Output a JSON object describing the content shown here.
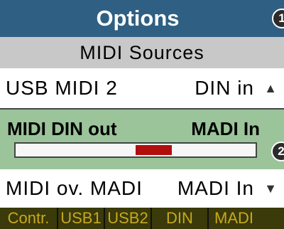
{
  "window": {
    "title": "Options"
  },
  "badges": {
    "one": "1",
    "two": "2"
  },
  "subheader": {
    "text": "MIDI Sources"
  },
  "rows": {
    "usb": {
      "label": "USB MIDI 2",
      "value": "DIN in",
      "arrow": "▲"
    },
    "selected": {
      "label": "MIDI DIN out",
      "value": "MADI In",
      "level": {
        "start_fraction": 0.5,
        "end_fraction": 0.65
      }
    },
    "madi": {
      "label": "MIDI ov. MADI",
      "value": "MADI In",
      "arrow": "▼"
    }
  },
  "tabs": [
    {
      "label": "Contr."
    },
    {
      "label": "USB1"
    },
    {
      "label": "USB2"
    },
    {
      "label": "DIN"
    },
    {
      "label": "MADI"
    }
  ],
  "colors": {
    "title_bg": "#2f5f82",
    "subheader_bg": "#c8c8c8",
    "selected_bg": "#9bc49a",
    "level_fill": "#b10e0e",
    "tab_bg": "#3a3a0a",
    "tab_text": "#c8a81e"
  }
}
